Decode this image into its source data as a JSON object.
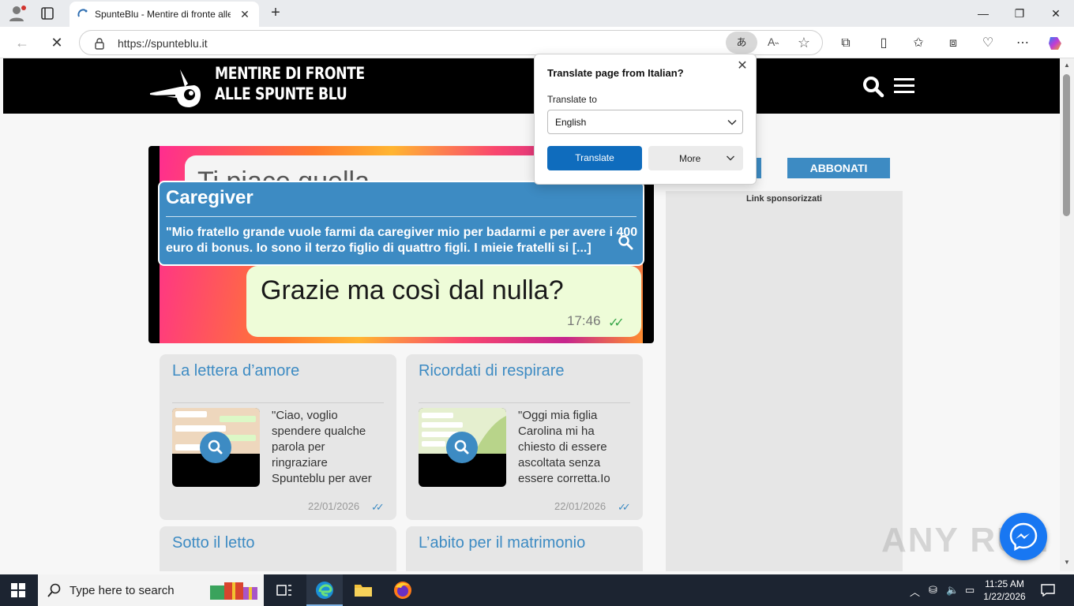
{
  "browser": {
    "tab_title": "SpunteBlu - Mentire di fronte alle",
    "url": "https://spunteblu.it",
    "translate_indicator": "あ",
    "read_aloud": "A˵"
  },
  "site": {
    "logo_line1": "MENTIRE DI FRONTE",
    "logo_line2": "ALLE SPUNTE BLU",
    "hero": {
      "bubble_top_text": "Ti piace quella",
      "bubble_bottom_text": "Grazie ma così dal nulla?",
      "bubble_time": "17:46",
      "title": "Caregiver",
      "excerpt": "\"Mio fratello grande vuole farmi da caregiver mio per badarmi e per avere i 400 euro di bonus. Io sono il terzo figlio di quattro figli. I mieie fratelli si [...]"
    },
    "cards": [
      {
        "title": "La lettera d’amore",
        "excerpt": "\"Ciao, voglio spendere qualche parola per ringraziare Spunteblu per aver",
        "date": "22/01/2026"
      },
      {
        "title": "Ricordati di respirare",
        "excerpt": "\"Oggi mia figlia Carolina mi ha chiesto di essere ascoltata senza essere corretta.Io",
        "date": "22/01/2026"
      },
      {
        "title": "Sotto il letto"
      },
      {
        "title": "L’abito per il matrimonio"
      }
    ],
    "subscribe_label": "ABBONATI",
    "sponsored_label": "Link sponsorizzati",
    "watermark": "ANY RUN"
  },
  "translate_popup": {
    "title": "Translate page from Italian?",
    "label": "Translate to",
    "selected_language": "English",
    "translate_button": "Translate",
    "more_button": "More"
  },
  "taskbar": {
    "search_placeholder": "Type here to search",
    "time": "11:25 AM",
    "date": "1/22/2026"
  },
  "colors": {
    "accent": "#3d8bc3",
    "edge_blue": "#0f6cbd",
    "header_black": "#000000",
    "taskbar": "#1c2431"
  },
  "icons": [
    "profile-icon",
    "tab-actions-icon",
    "close-icon",
    "plus-icon",
    "minimize-icon",
    "restore-icon",
    "back-icon",
    "stop-icon",
    "lock-icon",
    "star-icon",
    "extensions-icon",
    "split-screen-icon",
    "favorites-icon",
    "collections-icon",
    "performance-icon",
    "more-icon",
    "copilot-icon",
    "search-icon",
    "menu-icon",
    "chevron-down-icon",
    "messenger-icon",
    "windows-icon",
    "task-view-icon",
    "edge-icon",
    "folder-icon",
    "firefox-icon"
  ]
}
